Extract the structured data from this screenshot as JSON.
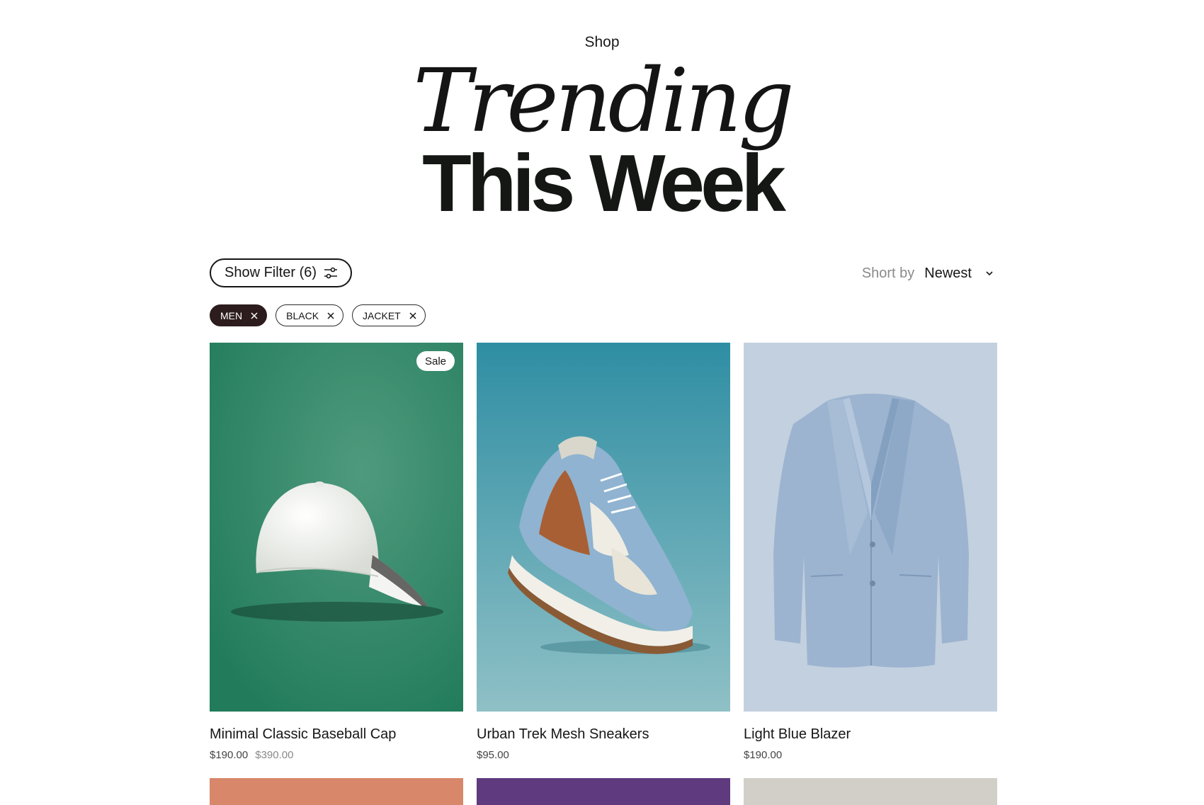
{
  "header": {
    "eyebrow": "Shop",
    "title_line1": "Trending",
    "title_line2": "This Week"
  },
  "toolbar": {
    "filter_label": "Show Filter (6)",
    "sort_label": "Short by",
    "sort_value": "Newest"
  },
  "chips": [
    {
      "label": "MEN",
      "active": true
    },
    {
      "label": "BLACK",
      "active": false
    },
    {
      "label": "JACKET",
      "active": false
    }
  ],
  "products": [
    {
      "name": "Minimal Classic Baseball Cap",
      "price": "$190.00",
      "old_price": "$390.00",
      "badge": "Sale",
      "image": "white-baseball-cap"
    },
    {
      "name": "Urban Trek Mesh Sneakers",
      "price": "$95.00",
      "image": "blue-mesh-sneaker"
    },
    {
      "name": "Light Blue Blazer",
      "price": "$190.00",
      "image": "light-blue-blazer"
    }
  ],
  "colors": {
    "cap_bg": "#2f8a6a",
    "sneaker_bg": "#3f99ab",
    "blazer_bg": "#c3d0df",
    "row2_1": "#d8876a",
    "row2_2": "#5f3a7e",
    "row2_3": "#d2cfc8",
    "active_chip": "#2d1c1d"
  }
}
